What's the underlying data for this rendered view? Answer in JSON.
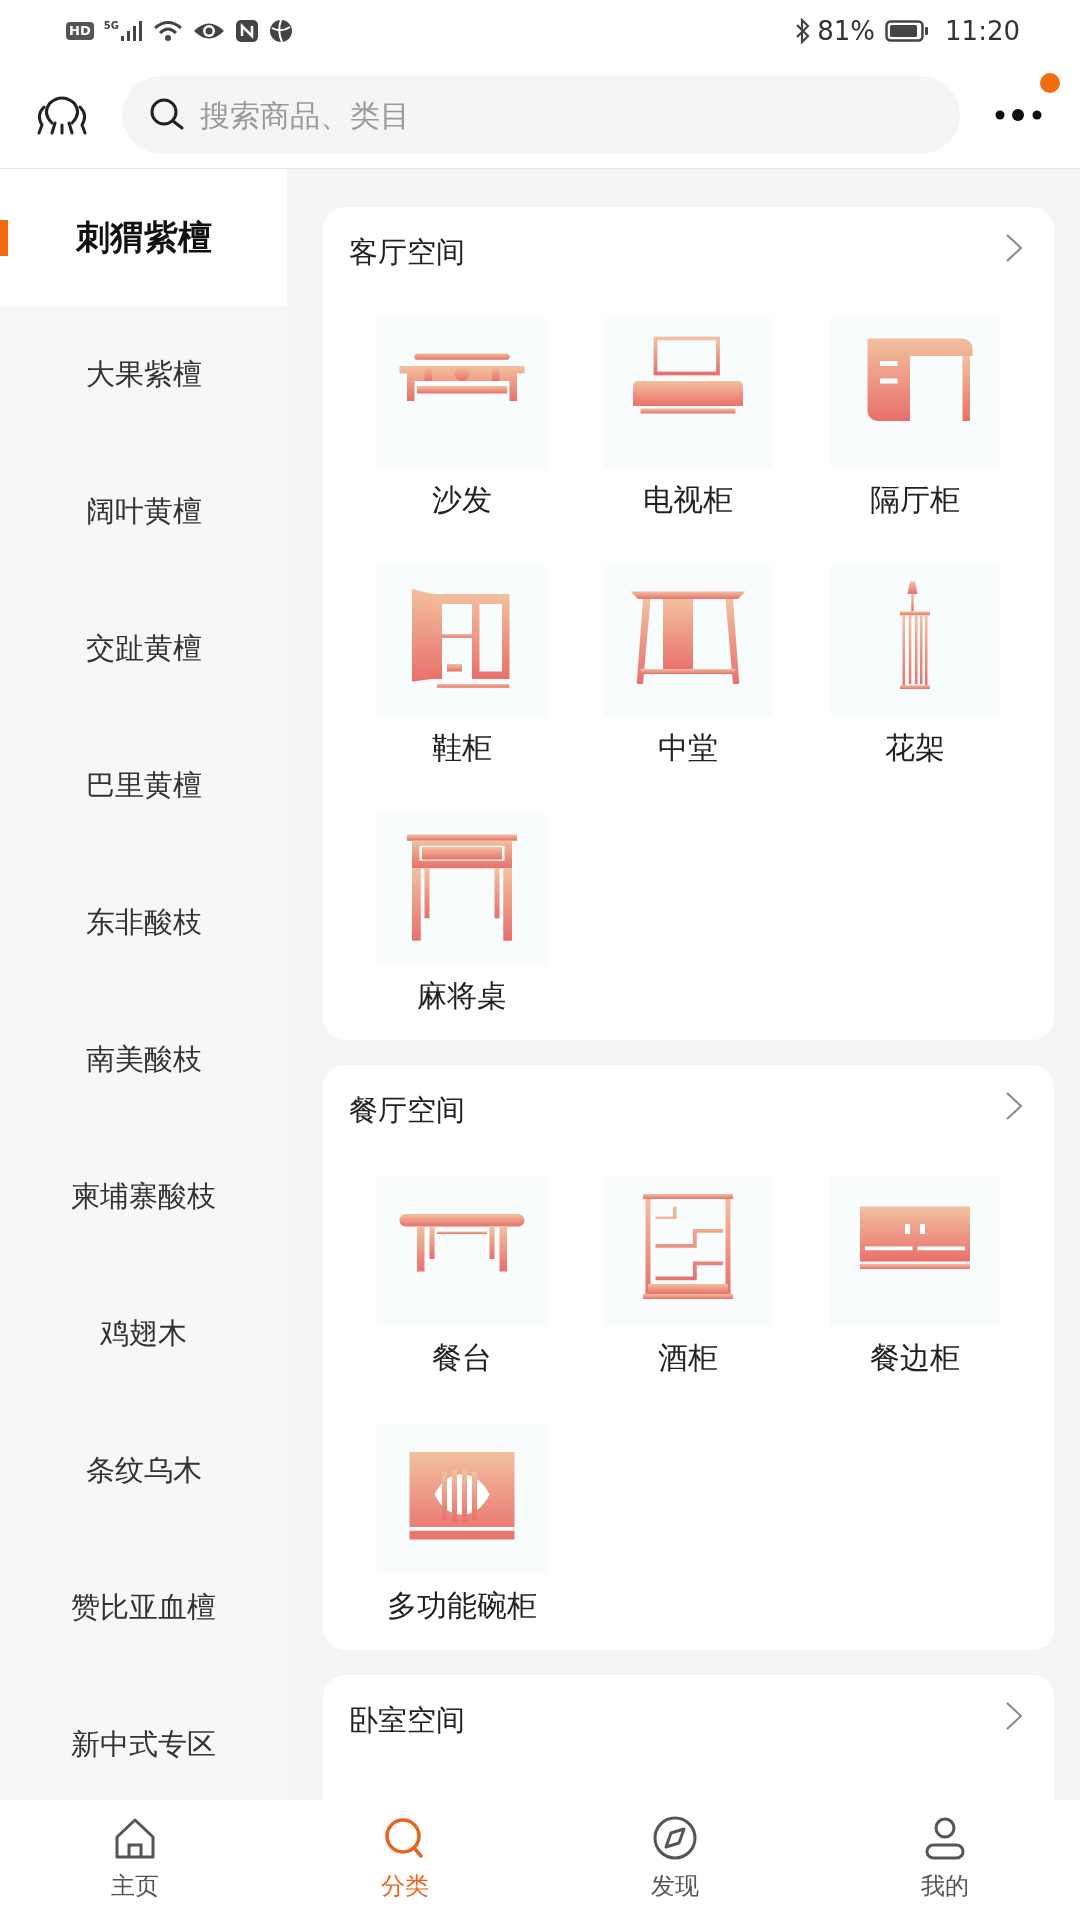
{
  "status_bar": {
    "hd": "HD",
    "network": "5G",
    "battery": "81%",
    "time": "11:20"
  },
  "header": {
    "search": {
      "placeholder": "搜索商品、类目"
    },
    "more_has_notification": true
  },
  "sidebar": {
    "items": [
      {
        "label": "刺猬紫檀",
        "selected": true
      },
      {
        "label": "大果紫檀",
        "selected": false
      },
      {
        "label": "阔叶黄檀",
        "selected": false
      },
      {
        "label": "交趾黄檀",
        "selected": false
      },
      {
        "label": "巴里黄檀",
        "selected": false
      },
      {
        "label": "东非酸枝",
        "selected": false
      },
      {
        "label": "南美酸枝",
        "selected": false
      },
      {
        "label": "柬埔寨酸枝",
        "selected": false
      },
      {
        "label": "鸡翅木",
        "selected": false
      },
      {
        "label": "条纹乌木",
        "selected": false
      },
      {
        "label": "赞比亚血檀",
        "selected": false
      },
      {
        "label": "新中式专区",
        "selected": false
      }
    ]
  },
  "sections": [
    {
      "title": "客厅空间",
      "items": [
        {
          "label": "沙发",
          "kind": "sofa"
        },
        {
          "label": "电视柜",
          "kind": "tv"
        },
        {
          "label": "隔厅柜",
          "kind": "desk"
        },
        {
          "label": "鞋柜",
          "kind": "cabinet"
        },
        {
          "label": "中堂",
          "kind": "console"
        },
        {
          "label": "花架",
          "kind": "stand"
        },
        {
          "label": "麻将桌",
          "kind": "table"
        }
      ]
    },
    {
      "title": "餐厅空间",
      "items": [
        {
          "label": "餐台",
          "kind": "bench"
        },
        {
          "label": "酒柜",
          "kind": "shelf"
        },
        {
          "label": "餐边柜",
          "kind": "sideboard"
        },
        {
          "label": "多功能碗柜",
          "kind": "chest"
        }
      ]
    },
    {
      "title": "卧室空间"
    }
  ],
  "tab_bar": [
    {
      "label": "主页",
      "kind": "home",
      "selected": false
    },
    {
      "label": "分类",
      "kind": "search",
      "selected": true
    },
    {
      "label": "发现",
      "kind": "compass",
      "selected": false
    },
    {
      "label": "我的",
      "kind": "person",
      "selected": false
    }
  ]
}
